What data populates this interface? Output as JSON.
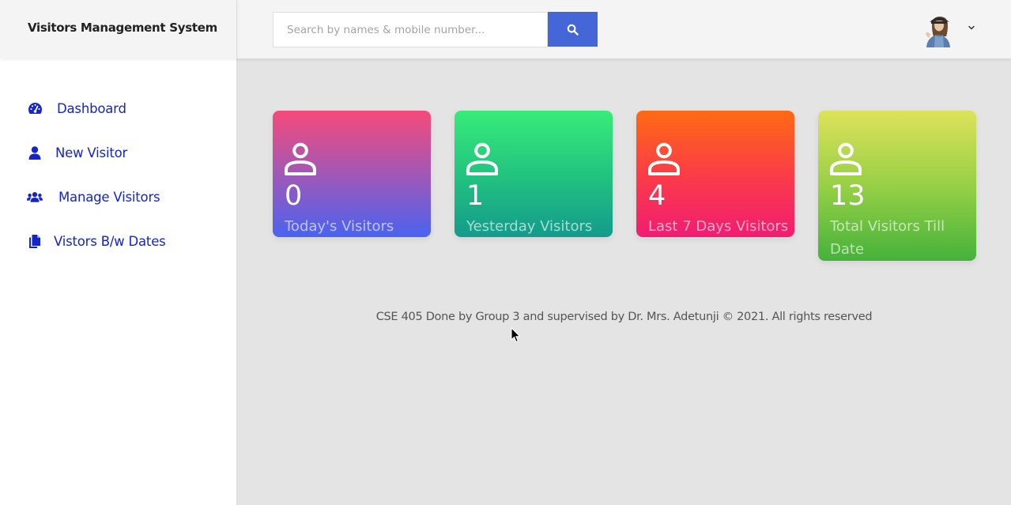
{
  "app": {
    "title": "Visitors Management System"
  },
  "search": {
    "placeholder": "Search by names & mobile number..."
  },
  "sidebar": {
    "items": [
      {
        "label": "Dashboard",
        "icon": "dashboard-icon"
      },
      {
        "label": "New Visitor",
        "icon": "user-icon"
      },
      {
        "label": "Manage Visitors",
        "icon": "users-icon"
      },
      {
        "label": "Vistors B/w Dates",
        "icon": "documents-icon"
      }
    ]
  },
  "cards": [
    {
      "value": "0",
      "label": "Today's Visitors",
      "icon": "person-icon"
    },
    {
      "value": "1",
      "label": "Yesterday Visitors",
      "icon": "person-icon"
    },
    {
      "value": "4",
      "label": "Last 7 Days Visitors",
      "icon": "person-icon"
    },
    {
      "value": "13",
      "label": "Total Visitors Till Date",
      "icon": "person-icon"
    }
  ],
  "footer": {
    "text": "CSE 405 Done by Group 3 and supervised by Dr. Mrs. Adetunji © 2021. All rights reserved"
  },
  "colors": {
    "accent": "#4466d6",
    "nav_text": "#1525c9",
    "card_today": [
      "#f64a7a",
      "#4a63f0"
    ],
    "card_yesterday": [
      "#38ec79",
      "#139b8c"
    ],
    "card_last7": [
      "#fe6a13",
      "#f11c72"
    ],
    "card_total": [
      "#dde25b",
      "#45b23b"
    ]
  }
}
